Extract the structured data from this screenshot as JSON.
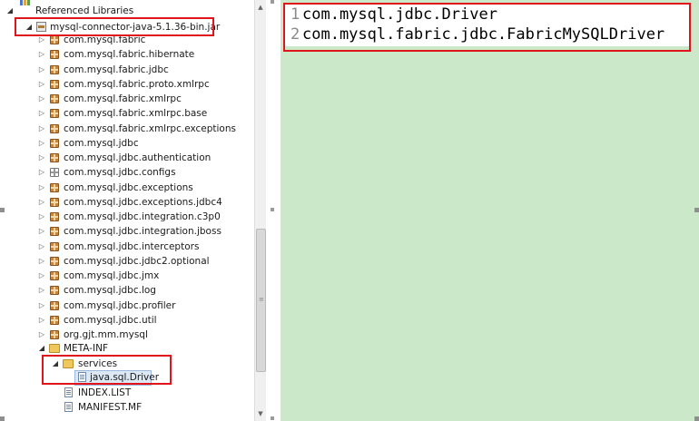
{
  "tree": {
    "root_label": "Referenced Libraries",
    "jar_label": "mysql-connector-java-5.1.36-bin.jar",
    "packages": [
      "com.mysql.fabric",
      "com.mysql.fabric.hibernate",
      "com.mysql.fabric.jdbc",
      "com.mysql.fabric.proto.xmlrpc",
      "com.mysql.fabric.xmlrpc",
      "com.mysql.fabric.xmlrpc.base",
      "com.mysql.fabric.xmlrpc.exceptions",
      "com.mysql.jdbc",
      "com.mysql.jdbc.authentication",
      "com.mysql.jdbc.configs",
      "com.mysql.jdbc.exceptions",
      "com.mysql.jdbc.exceptions.jdbc4",
      "com.mysql.jdbc.integration.c3p0",
      "com.mysql.jdbc.integration.jboss",
      "com.mysql.jdbc.interceptors",
      "com.mysql.jdbc.jdbc2.optional",
      "com.mysql.jdbc.jmx",
      "com.mysql.jdbc.log",
      "com.mysql.jdbc.profiler",
      "com.mysql.jdbc.util",
      "org.gjt.mm.mysql"
    ],
    "meta_inf_label": "META-INF",
    "services_label": "services",
    "driver_file_label": "java.sql.Driver",
    "index_list_label": "INDEX.LIST",
    "manifest_label": "MANIFEST.MF"
  },
  "editor": {
    "lines": [
      {
        "number": "1",
        "text": "com.mysql.jdbc.Driver"
      },
      {
        "number": "2",
        "text": "com.mysql.fabric.jdbc.FabricMySQLDriver"
      }
    ]
  },
  "colors": {
    "highlight_box": "#e0151b",
    "editor_background": "#cbe8c9"
  }
}
